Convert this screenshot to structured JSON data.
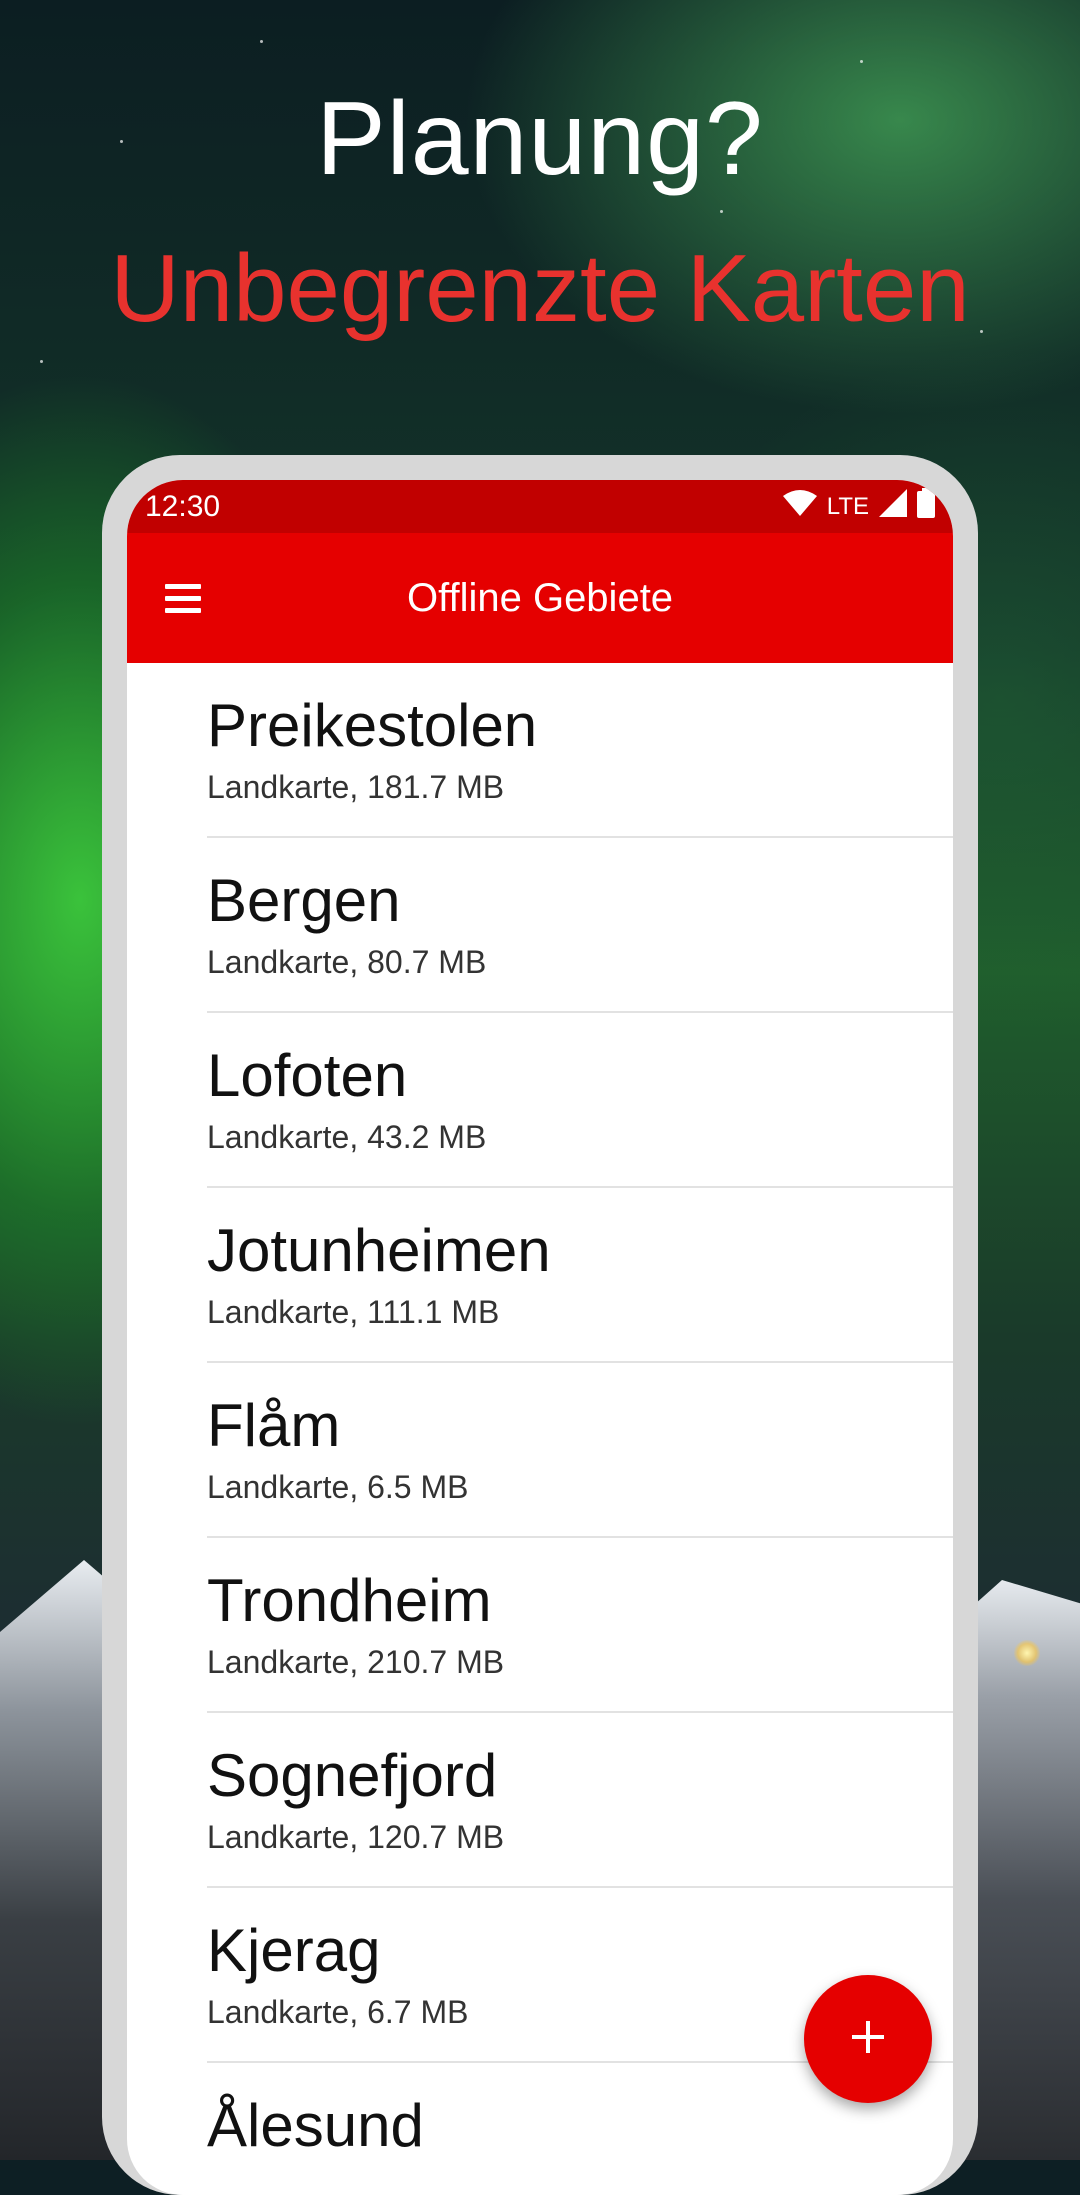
{
  "promo": {
    "headline": "Planung?",
    "subheadline": "Unbegrenzte Karten"
  },
  "status_bar": {
    "time": "12:30",
    "network": "LTE",
    "icons": [
      "wifi-icon",
      "signal-icon",
      "battery-icon"
    ]
  },
  "app_bar": {
    "title": "Offline Gebiete",
    "menu_icon": "menu-icon"
  },
  "areas": [
    {
      "name": "Preikestolen",
      "detail": "Landkarte, 181.7 MB"
    },
    {
      "name": "Bergen",
      "detail": "Landkarte, 80.7 MB"
    },
    {
      "name": "Lofoten",
      "detail": "Landkarte, 43.2 MB"
    },
    {
      "name": "Jotunheimen",
      "detail": "Landkarte, 111.1 MB"
    },
    {
      "name": "Flåm",
      "detail": "Landkarte, 6.5 MB"
    },
    {
      "name": "Trondheim",
      "detail": "Landkarte, 210.7 MB"
    },
    {
      "name": "Sognefjord",
      "detail": "Landkarte, 120.7 MB"
    },
    {
      "name": "Kjerag",
      "detail": "Landkarte, 6.7 MB"
    },
    {
      "name": "Ålesund",
      "detail": ""
    }
  ],
  "fab": {
    "icon": "plus-icon"
  },
  "colors": {
    "accent": "#e50000",
    "status_bar": "#c10000",
    "headline": "#ffffff",
    "subheadline": "#e8322e"
  }
}
